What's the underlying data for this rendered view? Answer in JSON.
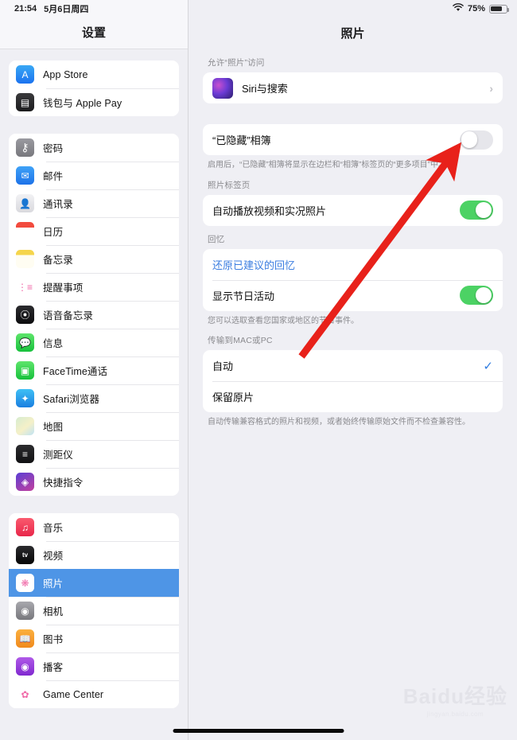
{
  "status_bar": {
    "time": "21:54",
    "date": "5月6日周四",
    "wifi_icon": "wifi-icon",
    "battery_percent": "75%",
    "battery_level": 75,
    "battery_icon": "battery-icon"
  },
  "sidebar": {
    "title": "设置",
    "groups": [
      {
        "items": [
          {
            "label": "App Store",
            "icon": "app-store-icon",
            "selected": false
          },
          {
            "label": "钱包与 Apple Pay",
            "icon": "wallet-icon",
            "selected": false
          }
        ]
      },
      {
        "items": [
          {
            "label": "密码",
            "icon": "passwords-key-icon",
            "selected": false
          },
          {
            "label": "邮件",
            "icon": "mail-icon",
            "selected": false
          },
          {
            "label": "通讯录",
            "icon": "contacts-icon",
            "selected": false
          },
          {
            "label": "日历",
            "icon": "calendar-icon",
            "selected": false
          },
          {
            "label": "备忘录",
            "icon": "notes-icon",
            "selected": false
          },
          {
            "label": "提醒事项",
            "icon": "reminders-icon",
            "selected": false
          },
          {
            "label": "语音备忘录",
            "icon": "voice-memos-icon",
            "selected": false
          },
          {
            "label": "信息",
            "icon": "messages-icon",
            "selected": false
          },
          {
            "label": "FaceTime通话",
            "icon": "facetime-icon",
            "selected": false
          },
          {
            "label": "Safari浏览器",
            "icon": "safari-icon",
            "selected": false
          },
          {
            "label": "地图",
            "icon": "maps-icon",
            "selected": false
          },
          {
            "label": "测距仪",
            "icon": "measure-icon",
            "selected": false
          },
          {
            "label": "快捷指令",
            "icon": "shortcuts-icon",
            "selected": false
          }
        ]
      },
      {
        "items": [
          {
            "label": "音乐",
            "icon": "music-icon",
            "selected": false
          },
          {
            "label": "视频",
            "icon": "apple-tv-icon",
            "selected": false
          },
          {
            "label": "照片",
            "icon": "photos-icon",
            "selected": true
          },
          {
            "label": "相机",
            "icon": "camera-icon",
            "selected": false
          },
          {
            "label": "图书",
            "icon": "books-icon",
            "selected": false
          },
          {
            "label": "播客",
            "icon": "podcasts-icon",
            "selected": false
          },
          {
            "label": "Game Center",
            "icon": "game-center-icon",
            "selected": false
          }
        ]
      }
    ]
  },
  "detail": {
    "title": "照片",
    "sections": {
      "access": {
        "header": "允许“照片”访问",
        "siri_row": {
          "label": "Siri与搜索",
          "icon": "siri-icon",
          "chevron": "chevron-right-icon"
        }
      },
      "hidden_album": {
        "label": "“已隐藏”相簿",
        "toggle_state": "off",
        "footer": "启用后，“已隐藏”相簿将显示在边栏和“相簿”标签页的“更多项目”中。"
      },
      "photos_tab": {
        "header": "照片标签页",
        "autoplay": {
          "label": "自动播放视频和实况照片",
          "toggle_state": "on"
        }
      },
      "memories": {
        "header": "回忆",
        "reset_link": "还原已建议的回忆",
        "holidays": {
          "label": "显示节日活动",
          "toggle_state": "on"
        },
        "footer": "您可以选取查看您国家或地区的节日事件。"
      },
      "transfer": {
        "header": "传输到MAC或PC",
        "options": [
          {
            "label": "自动",
            "checked": true
          },
          {
            "label": "保留原片",
            "checked": false
          }
        ],
        "footer": "自动传输兼容格式的照片和视频，或者始终传输原始文件而不检查兼容性。"
      }
    }
  },
  "annotation": {
    "arrow_icon": "red-arrow-annotation",
    "color": "#e8211a",
    "points_to": "“已隐藏”相簿 toggle"
  },
  "watermark": {
    "text": "Baidu经验",
    "subtext": "jingyan.baidu.com"
  },
  "colors": {
    "accent_blue": "#4e95e6",
    "toggle_green": "#4cd264",
    "link_blue": "#3b7de0",
    "annotation_red": "#e8211a"
  }
}
